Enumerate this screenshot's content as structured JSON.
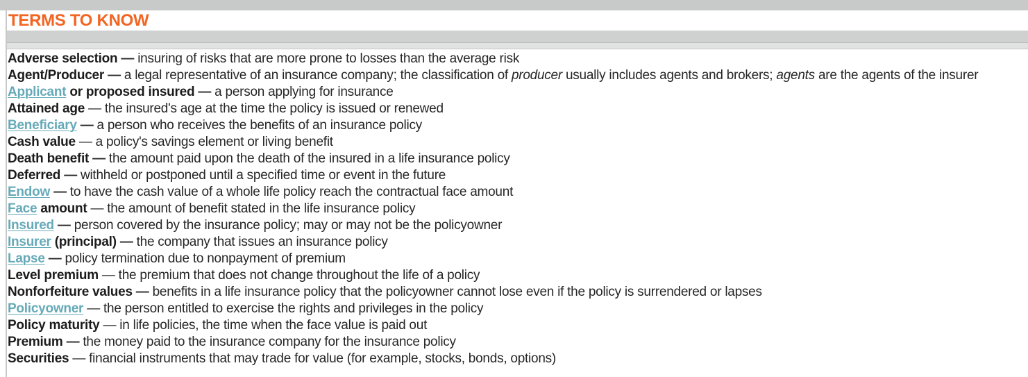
{
  "title": "TERMS TO KNOW",
  "colors": {
    "title": "#f26522",
    "link": "#66aab8",
    "text": "#262626",
    "band": "#cfd0d0"
  },
  "terms": [
    {
      "word": "Adverse selection",
      "dash": "—",
      "definition": "insuring of risks that are more prone to losses than the average risk"
    },
    {
      "word": "Agent/Producer",
      "dash": "—",
      "def_part1": "a legal representative of an insurance company; the classification of ",
      "def_italic1": "producer",
      "def_part2": " usually includes agents and brokers; ",
      "def_italic2": "agents",
      "def_part3": " are the agents of the insurer"
    },
    {
      "link": "Applicant",
      "word_rest": " or proposed insured",
      "dash": "—",
      "definition": "a person applying for insurance"
    },
    {
      "word": "Attained age",
      "dash": "—",
      "definition": "the insured's age at the time the policy is issued or renewed"
    },
    {
      "link": "Beneficiary",
      "dash": "—",
      "definition": "a person who receives the benefits of an insurance policy"
    },
    {
      "word": "Cash value",
      "dash": "—",
      "definition": "a policy's savings element or living benefit"
    },
    {
      "word": "Death benefit",
      "dash": "—",
      "definition": "the amount paid upon the death of the insured in a life insurance policy"
    },
    {
      "word": "Deferred",
      "dash": "—",
      "definition": "withheld or postponed until a specified time or event in the future"
    },
    {
      "link": "Endow",
      "dash": "—",
      "definition": "to have the cash value of a whole life policy reach the contractual face amount"
    },
    {
      "link": "Face",
      "word_rest": " amount",
      "dash": "—",
      "definition": "the amount of benefit stated in the life insurance policy"
    },
    {
      "link": "Insured",
      "dash": "—",
      "definition": "person covered by the insurance policy; may or may not be the policyowner"
    },
    {
      "link": "Insurer",
      "word_rest": " (principal)",
      "dash": "—",
      "definition": "the company that issues an insurance policy"
    },
    {
      "link": "Lapse",
      "dash": "—",
      "definition": "policy termination due to nonpayment of premium"
    },
    {
      "word": "Level premium",
      "dash": "—",
      "definition": "the premium that does not change throughout the life of a policy"
    },
    {
      "word": "Nonforfeiture values",
      "dash": "—",
      "definition": "benefits in a life insurance policy that the policyowner cannot lose even if the policy is surrendered or lapses"
    },
    {
      "link": "Policyowner",
      "dash": "—",
      "definition": "the person entitled to exercise the rights and privileges in the policy"
    },
    {
      "word": "Policy maturity",
      "dash": "—",
      "definition": "in life policies, the time when the face value is paid out"
    },
    {
      "word": "Premium",
      "dash": "—",
      "definition": "the money paid to the insurance company for the insurance policy"
    },
    {
      "word": "Securities",
      "dash": "—",
      "definition": "financial instruments that may trade for value (for example, stocks, bonds, options)"
    }
  ]
}
